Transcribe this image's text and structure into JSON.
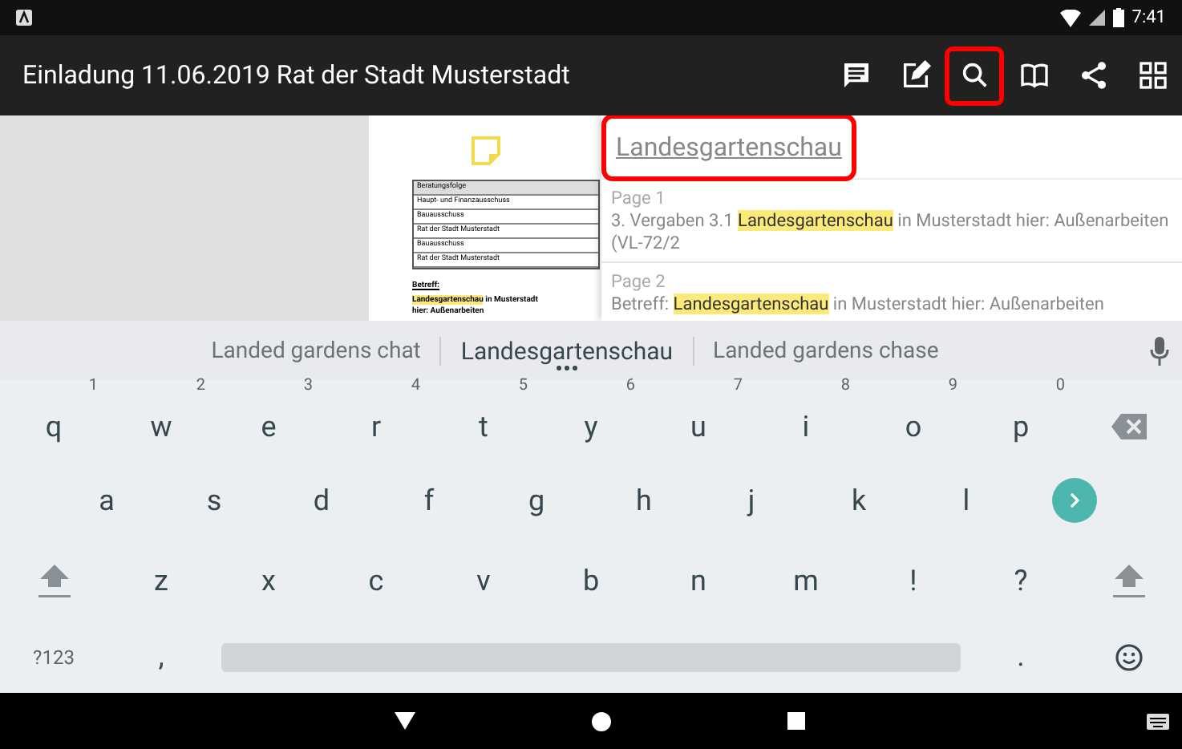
{
  "status_bar": {
    "time": "7:41"
  },
  "app_bar": {
    "title": "Einladung 11.06.2019 Rat der Stadt Musterstadt",
    "actions": [
      {
        "kind": "comment",
        "marked": false
      },
      {
        "kind": "edit",
        "marked": false
      },
      {
        "kind": "search",
        "marked": true
      },
      {
        "kind": "book",
        "marked": false
      },
      {
        "kind": "share",
        "marked": false
      },
      {
        "kind": "grid",
        "marked": false
      }
    ]
  },
  "document": {
    "table_rows": [
      {
        "text": "Beratungsfolge",
        "header": true
      },
      {
        "text": "Haupt- und Finanzausschuss",
        "header": false
      },
      {
        "text": "Bauausschuss",
        "header": false
      },
      {
        "text": "Rat der Stadt Musterstadt",
        "header": false
      },
      {
        "text": "Bauausschuss",
        "header": false
      },
      {
        "text": "Rat der Stadt Musterstadt",
        "header": false
      }
    ],
    "subject_label": "Betreff:",
    "subject_match": "Landesgartenschau",
    "subject_rest": " in Musterstadt",
    "subject_line2": "hier: Außenarbeiten"
  },
  "search_panel": {
    "query": "Landesgartenschau",
    "marked": true,
    "results": [
      {
        "page": "Page 1",
        "before": "3. Vergaben 3.1 ",
        "match": "Landesgartenschau",
        "after": " in Musterstadt hier: Außenarbeiten (VL-72/2"
      },
      {
        "page": "Page 2",
        "before": "Betreff: ",
        "match": "Landesgartenschau",
        "after": " in Musterstadt hier: Außenarbeiten"
      }
    ]
  },
  "keyboard": {
    "suggestions": [
      {
        "text": "Landed gardens chat",
        "selected": false
      },
      {
        "text": "Landesgartenschau",
        "selected": true
      },
      {
        "text": "Landed gardens chase",
        "selected": false
      }
    ],
    "rows": [
      {
        "keys": [
          {
            "kind": "char",
            "label": "q",
            "hint": "1"
          },
          {
            "kind": "char",
            "label": "w",
            "hint": "2"
          },
          {
            "kind": "char",
            "label": "e",
            "hint": "3"
          },
          {
            "kind": "char",
            "label": "r",
            "hint": "4"
          },
          {
            "kind": "char",
            "label": "t",
            "hint": "5"
          },
          {
            "kind": "char",
            "label": "y",
            "hint": "6"
          },
          {
            "kind": "char",
            "label": "u",
            "hint": "7"
          },
          {
            "kind": "char",
            "label": "i",
            "hint": "8"
          },
          {
            "kind": "char",
            "label": "o",
            "hint": "9"
          },
          {
            "kind": "char",
            "label": "p",
            "hint": "0"
          },
          {
            "kind": "backspace"
          }
        ]
      },
      {
        "keys": [
          {
            "kind": "char",
            "label": "a"
          },
          {
            "kind": "char",
            "label": "s"
          },
          {
            "kind": "char",
            "label": "d"
          },
          {
            "kind": "char",
            "label": "f"
          },
          {
            "kind": "char",
            "label": "g"
          },
          {
            "kind": "char",
            "label": "h"
          },
          {
            "kind": "char",
            "label": "j"
          },
          {
            "kind": "char",
            "label": "k"
          },
          {
            "kind": "char",
            "label": "l"
          },
          {
            "kind": "enter"
          }
        ]
      },
      {
        "keys": [
          {
            "kind": "shift"
          },
          {
            "kind": "char",
            "label": "z"
          },
          {
            "kind": "char",
            "label": "x"
          },
          {
            "kind": "char",
            "label": "c"
          },
          {
            "kind": "char",
            "label": "v"
          },
          {
            "kind": "char",
            "label": "b"
          },
          {
            "kind": "char",
            "label": "n"
          },
          {
            "kind": "char",
            "label": "m"
          },
          {
            "kind": "char",
            "label": "!"
          },
          {
            "kind": "char",
            "label": "?"
          },
          {
            "kind": "shift"
          }
        ]
      },
      {
        "keys": [
          {
            "kind": "symbols",
            "label": "?123"
          },
          {
            "kind": "char",
            "label": ","
          },
          {
            "kind": "space"
          },
          {
            "kind": "char",
            "label": "."
          },
          {
            "kind": "emoji"
          }
        ]
      }
    ]
  }
}
